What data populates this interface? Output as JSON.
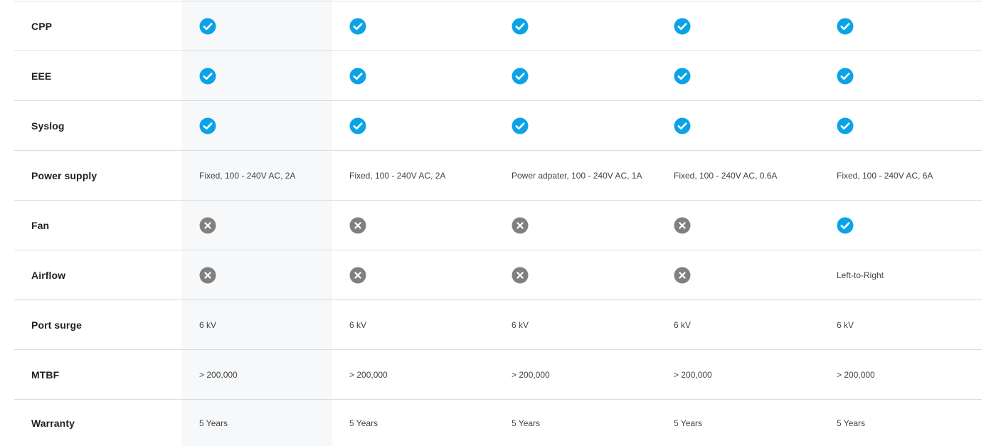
{
  "colors": {
    "check": "#0aa3e8",
    "cross": "#808080",
    "border": "#dcdcdc",
    "highlight": "#f7f8fa"
  },
  "rows": [
    {
      "label": "CPP",
      "cells": [
        {
          "type": "check"
        },
        {
          "type": "check"
        },
        {
          "type": "check"
        },
        {
          "type": "check"
        },
        {
          "type": "check"
        }
      ]
    },
    {
      "label": "EEE",
      "cells": [
        {
          "type": "check"
        },
        {
          "type": "check"
        },
        {
          "type": "check"
        },
        {
          "type": "check"
        },
        {
          "type": "check"
        }
      ]
    },
    {
      "label": "Syslog",
      "cells": [
        {
          "type": "check"
        },
        {
          "type": "check"
        },
        {
          "type": "check"
        },
        {
          "type": "check"
        },
        {
          "type": "check"
        }
      ]
    },
    {
      "label": "Power supply",
      "cells": [
        {
          "type": "text",
          "text": "Fixed, 100 - 240V AC, 2A"
        },
        {
          "type": "text",
          "text": "Fixed, 100 - 240V AC, 2A"
        },
        {
          "type": "text",
          "text": "Power adpater, 100 - 240V AC, 1A"
        },
        {
          "type": "text",
          "text": "Fixed, 100 - 240V AC, 0.6A"
        },
        {
          "type": "text",
          "text": "Fixed, 100 - 240V AC, 6A"
        }
      ]
    },
    {
      "label": "Fan",
      "cells": [
        {
          "type": "cross"
        },
        {
          "type": "cross"
        },
        {
          "type": "cross"
        },
        {
          "type": "cross"
        },
        {
          "type": "check"
        }
      ]
    },
    {
      "label": "Airflow",
      "cells": [
        {
          "type": "cross"
        },
        {
          "type": "cross"
        },
        {
          "type": "cross"
        },
        {
          "type": "cross"
        },
        {
          "type": "text",
          "text": "Left-to-Right"
        }
      ]
    },
    {
      "label": "Port surge",
      "cells": [
        {
          "type": "text",
          "text": "6 kV"
        },
        {
          "type": "text",
          "text": "6 kV"
        },
        {
          "type": "text",
          "text": "6 kV"
        },
        {
          "type": "text",
          "text": "6 kV"
        },
        {
          "type": "text",
          "text": "6 kV"
        }
      ]
    },
    {
      "label": "MTBF",
      "cells": [
        {
          "type": "text",
          "text": "> 200,000"
        },
        {
          "type": "text",
          "text": "> 200,000"
        },
        {
          "type": "text",
          "text": "> 200,000"
        },
        {
          "type": "text",
          "text": "> 200,000"
        },
        {
          "type": "text",
          "text": "> 200,000"
        }
      ]
    },
    {
      "label": "Warranty",
      "cells": [
        {
          "type": "text",
          "text": "5 Years"
        },
        {
          "type": "text",
          "text": "5 Years"
        },
        {
          "type": "text",
          "text": "5 Years"
        },
        {
          "type": "text",
          "text": "5 Years"
        },
        {
          "type": "text",
          "text": "5 Years"
        }
      ]
    }
  ]
}
